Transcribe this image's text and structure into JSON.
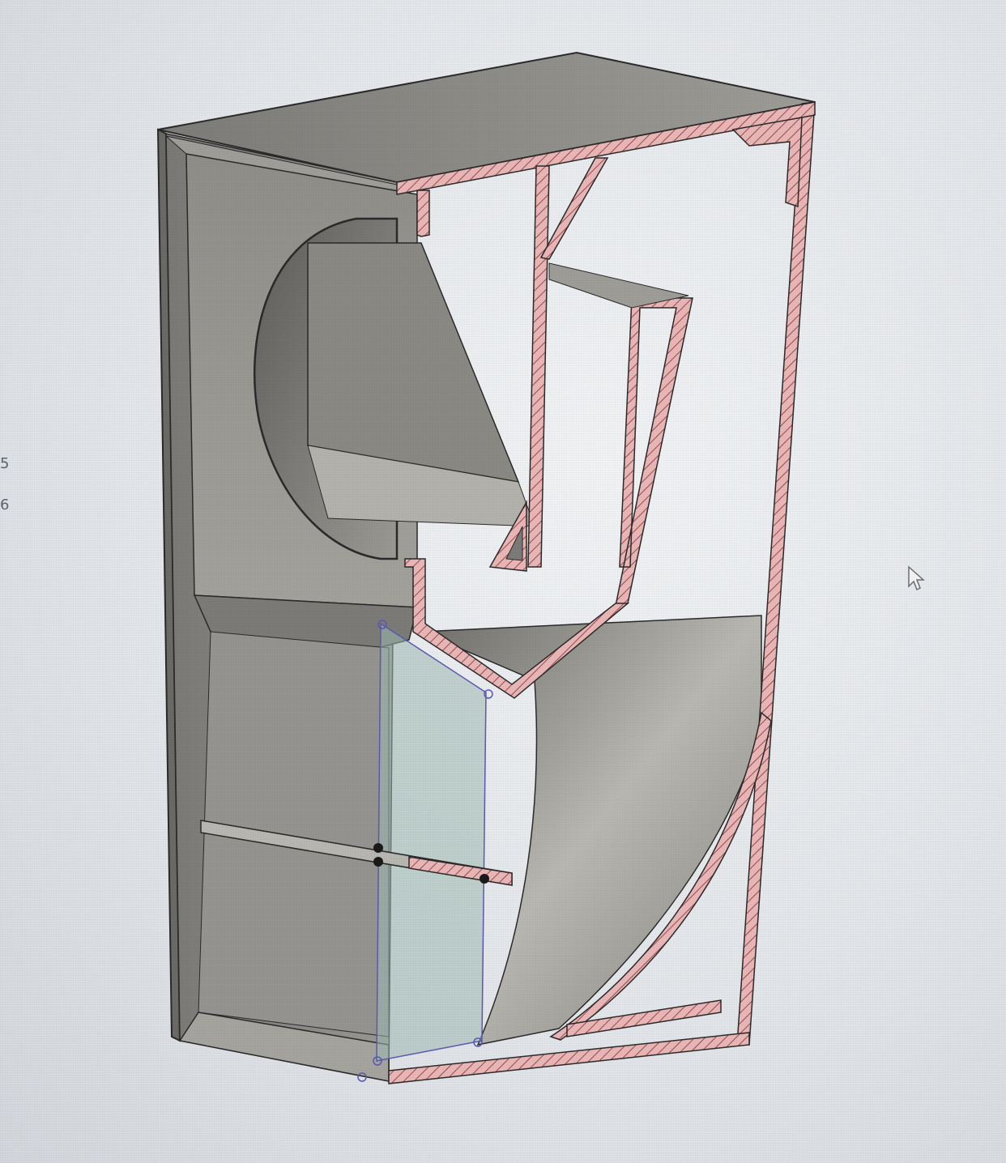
{
  "viewport": {
    "background": "#e6e9ec",
    "model": "speaker-enclosure-section-view"
  },
  "edge_labels": {
    "digit_1": "5",
    "digit_2": "6"
  },
  "colors": {
    "body_face": "#8a8985",
    "body_dark": "#6b6a66",
    "body_light": "#b0afaa",
    "section_fill": "#e9b7b7",
    "section_hatch": "#9b4a4a",
    "edge": "#2a2a2a",
    "sketch_plane": "#9fb9b3",
    "sketch_point": "#5a5ab0"
  },
  "icons": {
    "cursor": "arrow-cursor-icon"
  }
}
